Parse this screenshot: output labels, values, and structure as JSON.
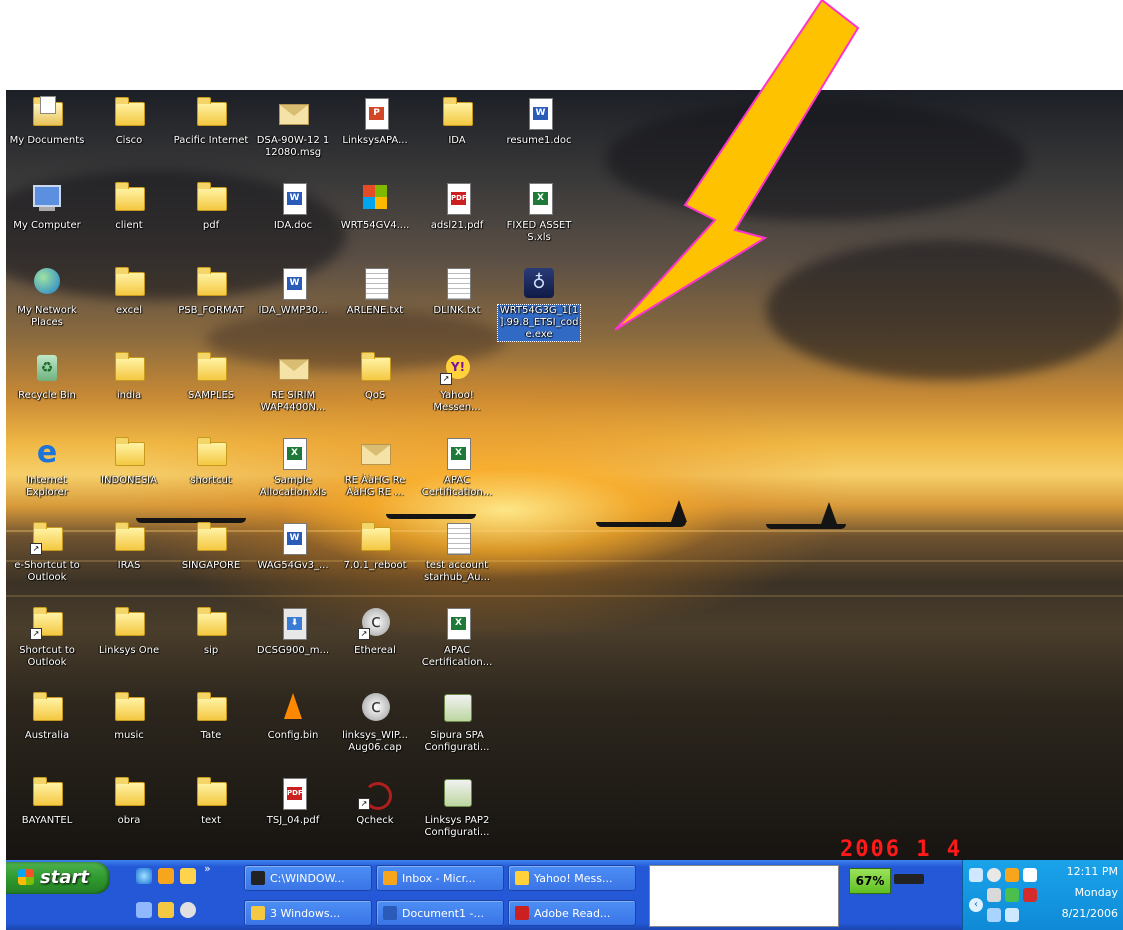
{
  "icons": [
    {
      "label": "My Documents",
      "kind": "mydocs"
    },
    {
      "label": "Cisco",
      "kind": "folder"
    },
    {
      "label": "Pacific Internet",
      "kind": "folder"
    },
    {
      "label": "DSA-90W-12 1 12080.msg",
      "kind": "envelope"
    },
    {
      "label": "LinksysAPA...",
      "kind": "ppt"
    },
    {
      "label": "IDA",
      "kind": "folder"
    },
    {
      "label": "resume1.doc",
      "kind": "word"
    },
    {
      "label": "My Computer",
      "kind": "computer"
    },
    {
      "label": "client",
      "kind": "folder"
    },
    {
      "label": "pdf",
      "kind": "folder"
    },
    {
      "label": "IDA.doc",
      "kind": "word"
    },
    {
      "label": "WRT54GV4....",
      "kind": "office"
    },
    {
      "label": "adsl21.pdf",
      "kind": "pdf"
    },
    {
      "label": "FIXED ASSET S.xls",
      "kind": "excel"
    },
    {
      "label": "My Network Places",
      "kind": "network"
    },
    {
      "label": "excel",
      "kind": "folder"
    },
    {
      "label": "PSB_FORMAT",
      "kind": "folder"
    },
    {
      "label": "IDA_WMP30...",
      "kind": "word"
    },
    {
      "label": "ARLENE.txt",
      "kind": "text"
    },
    {
      "label": "DLINK.txt",
      "kind": "text"
    },
    {
      "label": "WRT54G3G_1[1].99.8_ETSI_code.exe",
      "kind": "exe",
      "selected": true
    },
    {
      "label": "Recycle Bin",
      "kind": "recycle"
    },
    {
      "label": "india",
      "kind": "folder"
    },
    {
      "label": "SAMPLES",
      "kind": "folder"
    },
    {
      "label": "RE SIRIM WAP4400N...",
      "kind": "envelope"
    },
    {
      "label": "QoS",
      "kind": "folder"
    },
    {
      "label": "Yahoo! Messen...",
      "kind": "yahoo",
      "shortcut": true
    },
    {
      "label": "Internet Explorer",
      "kind": "ie"
    },
    {
      "label": "INDONESIA",
      "kind": "folder"
    },
    {
      "label": "shortcut",
      "kind": "folder"
    },
    {
      "label": "Sample Allocation.xls",
      "kind": "excel"
    },
    {
      "label": "RE ÀàHG Re ÀàHG RE ...",
      "kind": "envelope"
    },
    {
      "label": "APAC Certification...",
      "kind": "excel"
    },
    {
      "label": "e-Shortcut to Outlook",
      "kind": "folder",
      "shortcut": true
    },
    {
      "label": "IRAS",
      "kind": "folder"
    },
    {
      "label": "SINGAPORE",
      "kind": "folder"
    },
    {
      "label": "WAG54Gv3_...",
      "kind": "word"
    },
    {
      "label": "7.0.1_reboot",
      "kind": "folder"
    },
    {
      "label": "test account starhub_Au...",
      "kind": "text"
    },
    {
      "label": "Shortcut to Outlook",
      "kind": "folder",
      "shortcut": true
    },
    {
      "label": "Linksys One",
      "kind": "folder"
    },
    {
      "label": "sip",
      "kind": "folder"
    },
    {
      "label": "DCSG900_m...",
      "kind": "setup"
    },
    {
      "label": "Ethereal",
      "kind": "ethereal",
      "shortcut": true
    },
    {
      "label": "APAC Certification...",
      "kind": "excel"
    },
    {
      "label": "Australia",
      "kind": "folder"
    },
    {
      "label": "music",
      "kind": "folder"
    },
    {
      "label": "Tate",
      "kind": "folder"
    },
    {
      "label": "Config.bin",
      "kind": "vlc"
    },
    {
      "label": "linksys_WIP... Aug06.cap",
      "kind": "ethereal"
    },
    {
      "label": "Sipura SPA Configurati...",
      "kind": "sipura"
    },
    {
      "label": "BAYANTEL",
      "kind": "folder"
    },
    {
      "label": "obra",
      "kind": "folder"
    },
    {
      "label": "text",
      "kind": "folder"
    },
    {
      "label": "TSJ_04.pdf",
      "kind": "pdf"
    },
    {
      "label": "Qcheck",
      "kind": "qcheck",
      "shortcut": true
    },
    {
      "label": "Linksys PAP2 Configurati...",
      "kind": "sipura"
    }
  ],
  "taskbar": {
    "start_label": "start",
    "tasks": [
      {
        "label": "C:\\WINDOW...",
        "icon": "cmd"
      },
      {
        "label": "Inbox - Micr...",
        "icon": "outlook"
      },
      {
        "label": "Yahoo! Mess...",
        "icon": "yahoo"
      },
      {
        "label": "3 Windows...",
        "icon": "folder"
      },
      {
        "label": "Document1 -...",
        "icon": "word"
      },
      {
        "label": "Adobe Read...",
        "icon": "pdf"
      }
    ],
    "battery_percent": "67%",
    "clock_time": "12:11 PM",
    "clock_day": "Monday",
    "clock_date": "8/21/2006"
  },
  "stamp": "2006  1  4",
  "colors": {
    "arrow_fill": "#ffc200",
    "arrow_outline": "#ff33cc",
    "selection": "#316ac5"
  }
}
